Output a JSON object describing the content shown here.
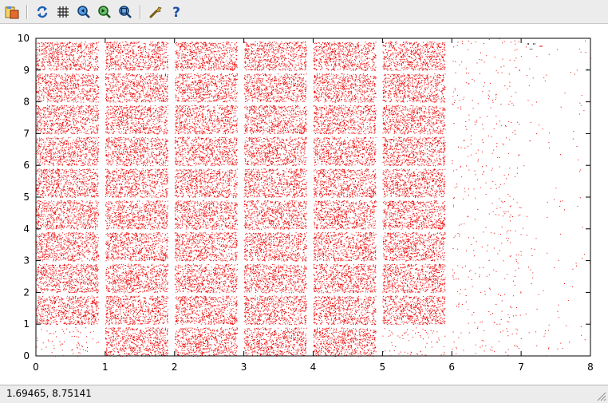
{
  "toolbar": {
    "buttons": [
      {
        "name": "export-icon",
        "tooltip": "Export"
      },
      {
        "name": "replot-icon",
        "tooltip": "Replot"
      },
      {
        "name": "grid-icon",
        "tooltip": "Grid"
      },
      {
        "name": "zoom-previous-icon",
        "tooltip": "Previous zoom"
      },
      {
        "name": "zoom-next-icon",
        "tooltip": "Next zoom"
      },
      {
        "name": "unzoom-icon",
        "tooltip": "Unzoom"
      },
      {
        "name": "options-icon",
        "tooltip": "Options"
      },
      {
        "name": "help-icon",
        "tooltip": "Help"
      }
    ]
  },
  "status": {
    "readout": "1.69465,  8.75141"
  },
  "chart_data": {
    "type": "scatter",
    "title": "",
    "xlabel": "",
    "ylabel": "",
    "xlim": [
      0,
      8
    ],
    "ylim": [
      0,
      10
    ],
    "xticks": [
      "0",
      "1",
      "2",
      "3",
      "4",
      "5",
      "6",
      "7",
      "8"
    ],
    "yticks": [
      "0",
      "1",
      "2",
      "3",
      "4",
      "5",
      "6",
      "7",
      "8",
      "9",
      "10"
    ],
    "grid": false,
    "legend_position": "top-right",
    "series": [
      {
        "name": "\"_\"",
        "color": "#ee0000",
        "marker": "dot",
        "description": "Dense uniform point clouds filling rectangular cells (x columns 0-0.9, 1-1.9, 2-2.9, 3-3.9, 4-4.9, 5-5.9; y rows of height 0.9 in every unit band from 0 to 10), with sparse points for x from 6 to 7, very sparse points for x from 7 to 8, and sparse points in the bottom row for columns 0 and 5.",
        "cells": {
          "x_columns": [
            [
              0,
              0.9
            ],
            [
              1,
              1.9
            ],
            [
              2,
              2.9
            ],
            [
              3,
              3.9
            ],
            [
              4,
              4.9
            ],
            [
              5,
              5.9
            ]
          ],
          "y_rows": [
            [
              0,
              0.9
            ],
            [
              1,
              1.9
            ],
            [
              2,
              2.9
            ],
            [
              3,
              3.9
            ],
            [
              4,
              4.9
            ],
            [
              5,
              5.9
            ],
            [
              6,
              6.9
            ],
            [
              7,
              7.9
            ],
            [
              8,
              8.9
            ],
            [
              9,
              9.9
            ]
          ],
          "sparse_cells": [
            [
              0,
              0
            ],
            [
              5,
              0
            ]
          ]
        },
        "sparse_regions": [
          {
            "x": [
              6,
              7
            ],
            "y": [
              0,
              10
            ],
            "density": "sparse"
          },
          {
            "x": [
              7,
              8
            ],
            "y": [
              0,
              10
            ],
            "density": "very sparse"
          }
        ]
      }
    ]
  }
}
